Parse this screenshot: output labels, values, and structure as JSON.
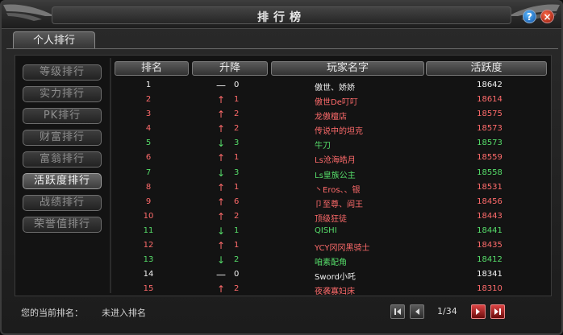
{
  "window": {
    "title": "排行榜"
  },
  "tabs": [
    {
      "label": "个人排行",
      "active": true
    }
  ],
  "sidebar": {
    "items": [
      {
        "label": "等级排行",
        "active": false
      },
      {
        "label": "实力排行",
        "active": false
      },
      {
        "label": "PK排行",
        "active": false
      },
      {
        "label": "财富排行",
        "active": false
      },
      {
        "label": "富翁排行",
        "active": false
      },
      {
        "label": "活跃度排行",
        "active": true
      },
      {
        "label": "战绩排行",
        "active": false
      },
      {
        "label": "荣誉值排行",
        "active": false
      }
    ]
  },
  "table": {
    "headers": [
      "排名",
      "升降",
      "玩家名字",
      "活跃度"
    ],
    "rows": [
      {
        "rank": "1",
        "trend": "same",
        "change": "0",
        "name": "傲世、娇娇",
        "activity": "18642",
        "color": "#f2f2f2"
      },
      {
        "rank": "2",
        "trend": "up",
        "change": "1",
        "name": "傲世De叮叮",
        "activity": "18614",
        "color": "#ff6b6b"
      },
      {
        "rank": "3",
        "trend": "up",
        "change": "2",
        "name": "龙傲檀店",
        "activity": "18575",
        "color": "#ff6b6b"
      },
      {
        "rank": "4",
        "trend": "up",
        "change": "2",
        "name": "传说中的坦克",
        "activity": "18573",
        "color": "#ff6b6b"
      },
      {
        "rank": "5",
        "trend": "down",
        "change": "3",
        "name": "牛刀",
        "activity": "18573",
        "color": "#56dd6a"
      },
      {
        "rank": "6",
        "trend": "up",
        "change": "1",
        "name": "Ls沧海皓月",
        "activity": "18559",
        "color": "#ff6b6b"
      },
      {
        "rank": "7",
        "trend": "down",
        "change": "3",
        "name": "Ls皇族公主",
        "activity": "18558",
        "color": "#56dd6a"
      },
      {
        "rank": "8",
        "trend": "up",
        "change": "1",
        "name": "丶Eros、、银",
        "activity": "18531",
        "color": "#ff6b6b"
      },
      {
        "rank": "9",
        "trend": "up",
        "change": "6",
        "name": "卩至尊、阎王",
        "activity": "18456",
        "color": "#ff6b6b"
      },
      {
        "rank": "10",
        "trend": "up",
        "change": "2",
        "name": "顶级狂徒",
        "activity": "18443",
        "color": "#ff6b6b"
      },
      {
        "rank": "11",
        "trend": "down",
        "change": "1",
        "name": "QISHI",
        "activity": "18441",
        "color": "#56dd6a"
      },
      {
        "rank": "12",
        "trend": "up",
        "change": "1",
        "name": "YCY冈冈黑骑士",
        "activity": "18435",
        "color": "#ff6b6b"
      },
      {
        "rank": "13",
        "trend": "down",
        "change": "2",
        "name": "咱素配角",
        "activity": "18412",
        "color": "#56dd6a"
      },
      {
        "rank": "14",
        "trend": "same",
        "change": "0",
        "name": "Sword小吒",
        "activity": "18341",
        "color": "#f2f2f2"
      },
      {
        "rank": "15",
        "trend": "up",
        "change": "2",
        "name": "夜袭寡妇床",
        "activity": "18310",
        "color": "#ff6b6b"
      }
    ]
  },
  "footer": {
    "my_rank_label": "您的当前排名：",
    "my_rank_value": "未进入排名",
    "page": "1/34"
  },
  "icons": {
    "trend_up": "↑",
    "trend_down": "↓",
    "trend_same": "—",
    "help": "?",
    "close": "×"
  },
  "colors": {
    "up": "#ff6b6b",
    "down": "#56dd6a",
    "same": "#f2f2f2",
    "page_next_accent": "#d44"
  }
}
